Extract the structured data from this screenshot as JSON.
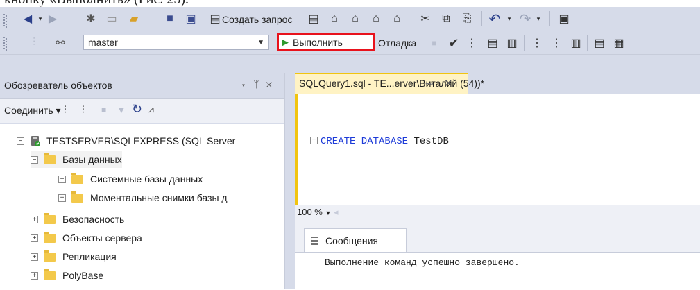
{
  "caption": {
    "text": "кнопку «Выполнить» (Рис. 25)."
  },
  "toolbar1": {
    "new_query_label": "Создать запрос",
    "buttons": [
      "back-icon",
      "forward-icon",
      "new-project-icon",
      "open-icon",
      "open-folder-icon",
      "save-icon",
      "save-all-icon",
      "new-query-icon",
      "mdx-icon",
      "dmx-icon",
      "xmla-icon",
      "dax-icon",
      "cut-icon",
      "copy-icon",
      "paste-icon",
      "undo-icon",
      "redo-icon"
    ]
  },
  "toolbar2": {
    "database_value": "master",
    "execute_label": "Выполнить",
    "debug_label": "Отладка"
  },
  "object_explorer": {
    "title": "Обозреватель объектов",
    "connect_label": "Соединить",
    "tree": [
      {
        "label": "TESTSERVER\\SQLEXPRESS (SQL Server",
        "level": 0,
        "expanded": true,
        "icon": "server-icon"
      },
      {
        "label": "Базы данных",
        "level": 1,
        "expanded": true,
        "icon": "folder-icon"
      },
      {
        "label": "Системные базы данных",
        "level": 2,
        "expanded": false,
        "icon": "folder-icon"
      },
      {
        "label": "Моментальные снимки базы д",
        "level": 2,
        "expanded": false,
        "icon": "folder-icon"
      },
      {
        "label": "Безопасность",
        "level": 1,
        "expanded": false,
        "icon": "folder-icon"
      },
      {
        "label": "Объекты сервера",
        "level": 1,
        "expanded": false,
        "icon": "folder-icon"
      },
      {
        "label": "Репликация",
        "level": 1,
        "expanded": false,
        "icon": "folder-icon"
      },
      {
        "label": "PolyBase",
        "level": 1,
        "expanded": false,
        "icon": "folder-icon"
      }
    ]
  },
  "editor": {
    "tab_title": "SQLQuery1.sql - TE...erver\\Виталий (54))*",
    "code_keyword": "CREATE DATABASE",
    "code_name": "TestDB",
    "zoom": "100 %"
  },
  "results": {
    "tab_label": "Сообщения",
    "message": "Выполнение команд успешно завершено."
  },
  "colors": {
    "highlight_border": "#e8121c",
    "toolbar_bg": "#d6dbe9",
    "tab_active": "#fff3c4",
    "keyword": "#1d3bd8"
  }
}
